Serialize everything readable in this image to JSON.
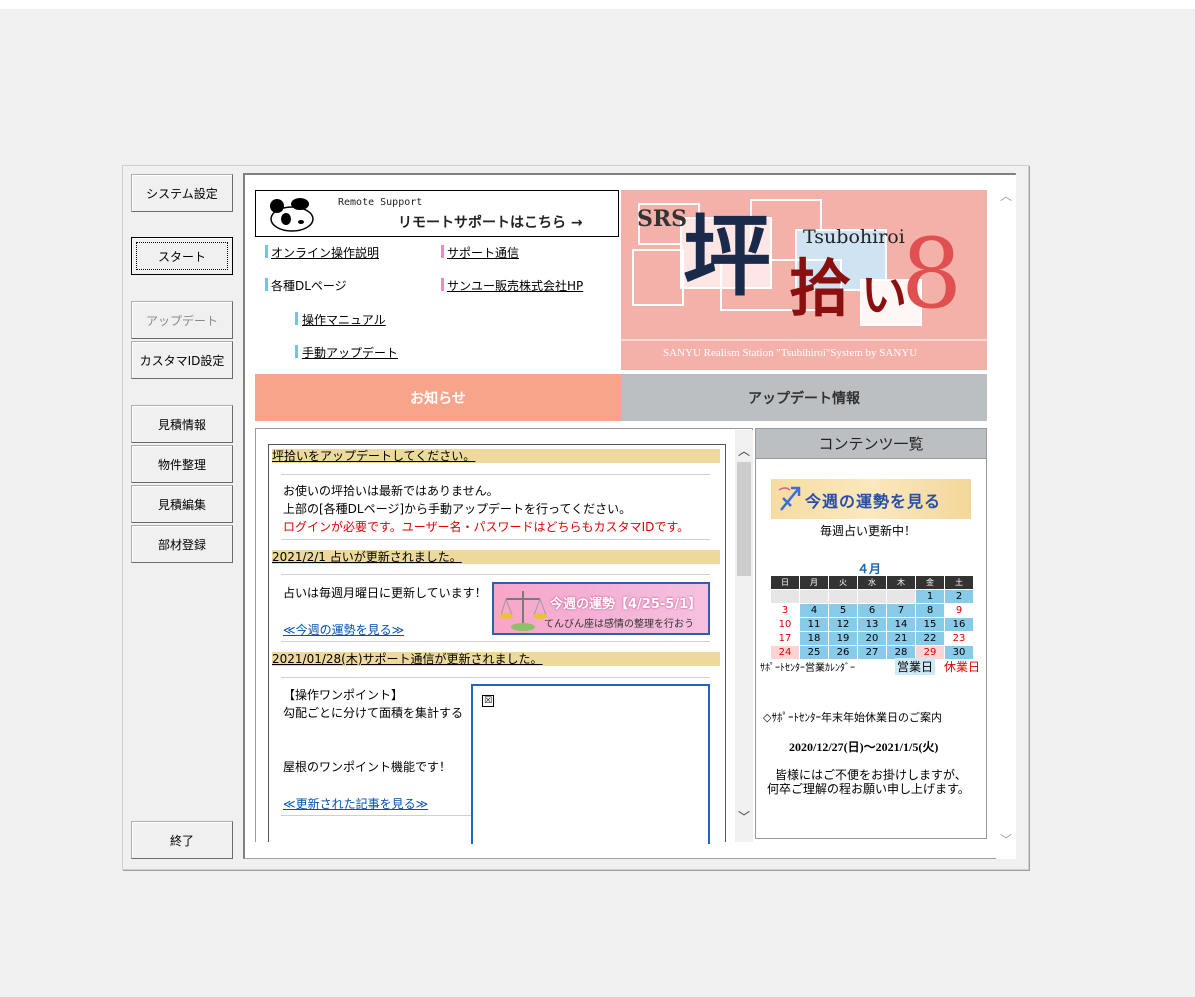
{
  "sidebar": {
    "system_settings": "システム設定",
    "start": "スタート",
    "update": "アップデート",
    "customer_id": "カスタマID設定",
    "estimate_info": "見積情報",
    "property": "物件整理",
    "estimate_edit": "見積編集",
    "materials": "部材登録",
    "exit": "終了"
  },
  "remote": {
    "small": "Remote Support",
    "big": "リモートサポートはこちら →"
  },
  "links": {
    "online_manual": "オンライン操作説明",
    "support_news": "サポート通信",
    "dl_pages": "各種DLページ",
    "sanyu_hp": "サンユー販売株式会社HP",
    "op_manual": "操作マニュアル",
    "manual_update": "手動アップデート"
  },
  "hero": {
    "srs": "SRS",
    "tsubohiroi": "Tsubohiroi",
    "kanji1": "坪",
    "kanji2": "拾",
    "kana": "い",
    "eight": "8",
    "caption": "SANYU Realism Station \"Tsubihiroi\"System by SANYU"
  },
  "tabs": {
    "news": "お知らせ",
    "updates": "アップデート情報"
  },
  "news": [
    {
      "header": "坪拾いをアップデートしてください。",
      "lines": [
        "お使いの坪拾いは最新ではありません。",
        "上部の[各種DLページ]から手動アップデートを行ってください。"
      ],
      "warning": "ログインが必要です。ユーザー名・パスワードはどちらもカスタマIDです。"
    },
    {
      "header": "2021/2/1 占いが更新されました。",
      "text": "占いは毎週月曜日に更新しています！",
      "link": "≪今週の運勢を見る≫",
      "banner_title": "今週の運勢【4/25-5/1】",
      "banner_sub": "てんびん座は感情の整理を行おう"
    },
    {
      "header": "2021/01/28(木)サポート通信が更新されました。",
      "title": "【操作ワンポイント】",
      "line1": "勾配ごとに分けて面積を集計する",
      "line2": "屋根のワンポイント機能です！",
      "link": "≪更新された記事を見る≫",
      "broken_icon": "☒"
    }
  ],
  "contents": {
    "title": "コンテンツ一覧",
    "fortune_banner": "今週の運勢を見る",
    "fortune_note": "毎週占い更新中！",
    "calendar": {
      "month": "４月",
      "weekdays": [
        "日",
        "月",
        "火",
        "水",
        "木",
        "金",
        "土"
      ],
      "rows": [
        [
          "",
          "",
          "",
          "",
          "",
          "1",
          "2"
        ],
        [
          "3",
          "4",
          "5",
          "6",
          "7",
          "8",
          "9"
        ],
        [
          "10",
          "11",
          "12",
          "13",
          "14",
          "15",
          "16"
        ],
        [
          "17",
          "18",
          "19",
          "20",
          "21",
          "22",
          "23"
        ],
        [
          "24",
          "25",
          "26",
          "27",
          "28",
          "29",
          "30"
        ]
      ]
    },
    "calendar_label": "ｻﾎﾟｰﾄｾﾝﾀｰ営業ｶﾚﾝﾀﾞｰ",
    "business_day": "営業日",
    "holiday": "休業日",
    "notice_title": "◇ｻﾎﾟｰﾄｾﾝﾀｰ年末年始休業日のご案内",
    "notice_dates": "2020/12/27(日)〜2021/1/5(火)",
    "notice_line1": "皆様にはご不便をお掛けしますが、",
    "notice_line2": "何卒ご理解の程お願い申し上げます。"
  },
  "colors": {
    "news_tab": "#f7a48b",
    "update_tab": "#bcbfc2",
    "news_header": "#ecd99b",
    "calendar_business": "#88cbe9",
    "holiday_red": "#e00000"
  }
}
